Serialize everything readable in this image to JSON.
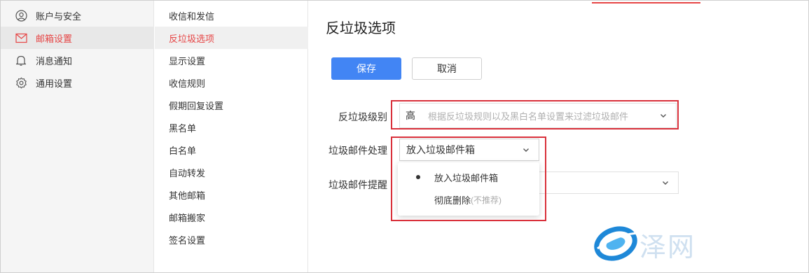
{
  "sidebar": {
    "items": [
      {
        "label": "账户与安全",
        "icon": "user-icon",
        "active": false
      },
      {
        "label": "邮箱设置",
        "icon": "mail-icon",
        "active": true
      },
      {
        "label": "消息通知",
        "icon": "bell-icon",
        "active": false
      },
      {
        "label": "通用设置",
        "icon": "gear-icon",
        "active": false
      }
    ]
  },
  "subnav": {
    "items": [
      {
        "label": "收信和发信",
        "active": false
      },
      {
        "label": "反垃圾选项",
        "active": true
      },
      {
        "label": "显示设置",
        "active": false
      },
      {
        "label": "收信规则",
        "active": false
      },
      {
        "label": "假期回复设置",
        "active": false
      },
      {
        "label": "黑名单",
        "active": false
      },
      {
        "label": "白名单",
        "active": false
      },
      {
        "label": "自动转发",
        "active": false
      },
      {
        "label": "其他邮箱",
        "active": false
      },
      {
        "label": "邮箱搬家",
        "active": false
      },
      {
        "label": "签名设置",
        "active": false
      }
    ]
  },
  "main": {
    "title": "反垃圾选项",
    "save_label": "保存",
    "cancel_label": "取消",
    "level": {
      "label": "反垃圾级别",
      "value": "高",
      "hint": "根据反垃圾规则以及黑白名单设置来过滤垃圾邮件"
    },
    "handling": {
      "label": "垃圾邮件处理",
      "value": "放入垃圾邮件箱",
      "options": [
        {
          "label": "放入垃圾邮件箱",
          "note": "",
          "selected": true
        },
        {
          "label": "彻底删除",
          "note": "(不推荐)",
          "selected": false
        }
      ]
    },
    "reminder": {
      "label": "垃圾邮件提醒"
    }
  },
  "watermark": {
    "text": "泽网"
  },
  "colors": {
    "accent_red": "#e64545",
    "primary_blue": "#4285f4",
    "highlight_box": "#d9303a"
  }
}
